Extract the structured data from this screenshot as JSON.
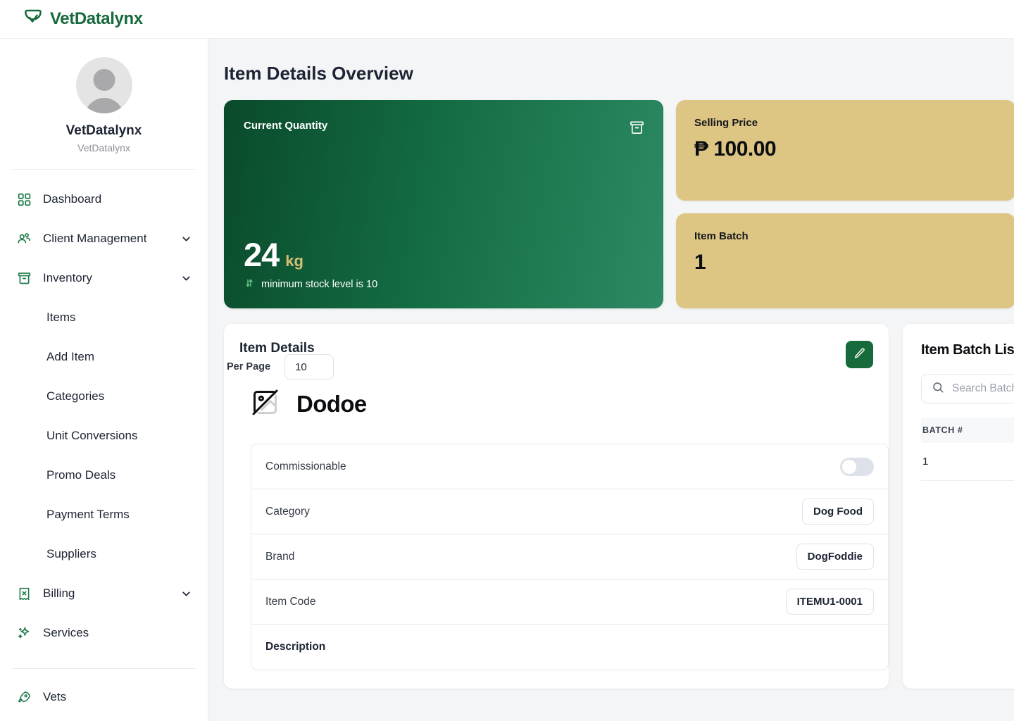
{
  "brand": {
    "name": "VetDatalynx",
    "logo_icon": "leaf-shield-icon",
    "accent": "#176a3b"
  },
  "sidebar": {
    "profile": {
      "name": "VetDatalynx",
      "subtitle": "VetDatalynx",
      "avatar_icon": "user-avatar-icon"
    },
    "items": [
      {
        "label": "Dashboard",
        "icon": "grid-icon",
        "expandable": false
      },
      {
        "label": "Client Management",
        "icon": "users-group-icon",
        "expandable": true
      },
      {
        "label": "Inventory",
        "icon": "archive-box-icon",
        "expandable": true
      }
    ],
    "inventory_children": [
      {
        "label": "Items"
      },
      {
        "label": "Add Item"
      },
      {
        "label": "Categories"
      },
      {
        "label": "Unit Conversions"
      },
      {
        "label": "Promo Deals"
      },
      {
        "label": "Payment Terms"
      },
      {
        "label": "Suppliers"
      }
    ],
    "items_lower": [
      {
        "label": "Billing",
        "icon": "receipt-icon",
        "expandable": true
      },
      {
        "label": "Services",
        "icon": "sparkle-icon",
        "expandable": false
      }
    ],
    "items_footer": [
      {
        "label": "Vets",
        "icon": "rocket-icon",
        "expandable": false
      }
    ]
  },
  "main": {
    "page_title": "Item Details Overview",
    "quantity_card": {
      "title": "Current Quantity",
      "icon": "archive-box-icon",
      "value": "24",
      "unit": "kg",
      "note": "minimum stock level is 10",
      "note_icon": "arrows-up-down-icon",
      "gradient_from": "#0a4a2b",
      "gradient_to": "#2d8a63"
    },
    "price_card": {
      "title": "Selling Price",
      "value": "₱ 100.00",
      "bg": "#ddc683"
    },
    "batch_card": {
      "title": "Item Batch",
      "value": "1",
      "bg": "#ddc683"
    },
    "details_panel": {
      "title": "Item Details",
      "edit_icon": "pencil-icon",
      "item_name": "Dodoe",
      "item_image_icon": "image-off-icon",
      "rows": [
        {
          "label": "Commissionable",
          "type": "toggle",
          "value": "off"
        },
        {
          "label": "Category",
          "type": "pill",
          "value": "Dog Food"
        },
        {
          "label": "Brand",
          "type": "pill",
          "value": "DogFoddie"
        },
        {
          "label": "Item Code",
          "type": "pill",
          "value": "ITEMU1-0001"
        },
        {
          "label": "Description",
          "type": "none",
          "value": ""
        }
      ]
    },
    "batch_panel": {
      "title": "Item Batch List",
      "search_placeholder": "Search Batch...",
      "search_value": "",
      "search_icon": "search-icon",
      "columns": [
        "BATCH #"
      ],
      "rows": [
        {
          "batch": "1"
        }
      ],
      "per_page_label": "Per Page",
      "per_page_value": "10"
    }
  }
}
